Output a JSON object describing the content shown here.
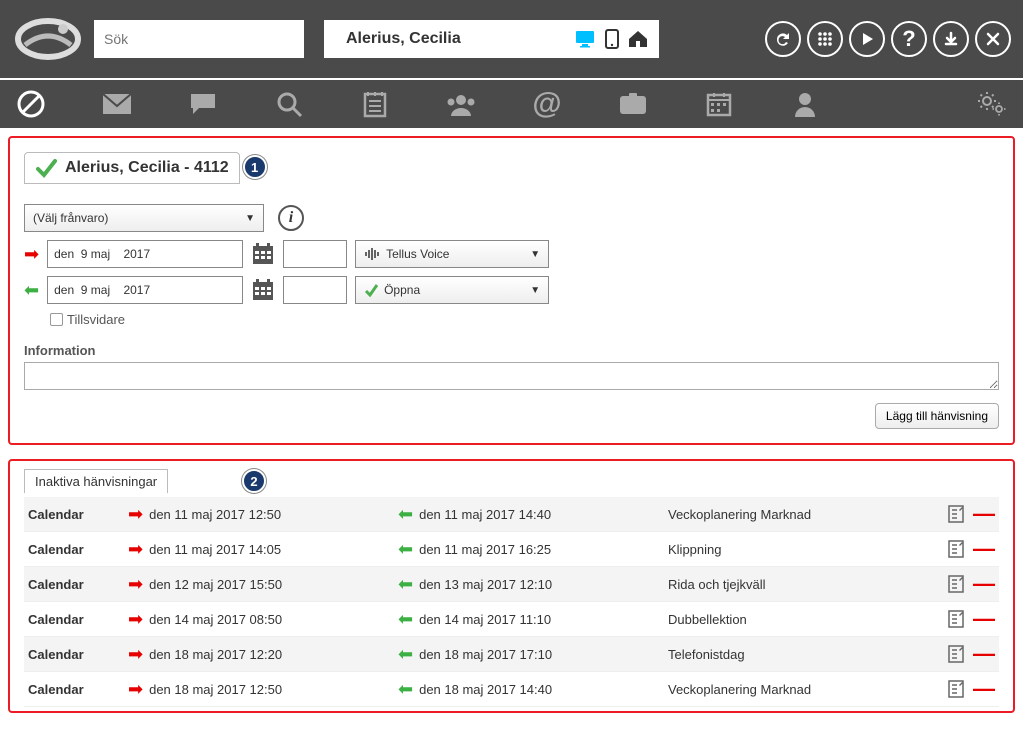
{
  "top": {
    "search_placeholder": "Sök",
    "user_name": "Alerius, Cecilia"
  },
  "panel1": {
    "title": "Alerius, Cecilia - 4112",
    "callout": "1",
    "absence_select": "(Välj frånvaro)",
    "date_out": "den  9 maj    2017",
    "date_in": "den  9 maj    2017",
    "voice_select": "Tellus Voice",
    "open_select": "Öppna",
    "tillsvidare": "Tillsvidare",
    "info_label": "Information",
    "add_btn": "Lägg till hänvisning"
  },
  "panel2": {
    "tab": "Inaktiva hänvisningar",
    "callout": "2",
    "rows": [
      {
        "source": "Calendar",
        "out": "den 11 maj 2017 12:50",
        "in": "den 11 maj 2017 14:40",
        "title": "Veckoplanering Marknad"
      },
      {
        "source": "Calendar",
        "out": "den 11 maj 2017 14:05",
        "in": "den 11 maj 2017 16:25",
        "title": "Klippning"
      },
      {
        "source": "Calendar",
        "out": "den 12 maj 2017 15:50",
        "in": "den 13 maj 2017 12:10",
        "title": "Rida och tjejkväll"
      },
      {
        "source": "Calendar",
        "out": "den 14 maj 2017 08:50",
        "in": "den 14 maj 2017 11:10",
        "title": "Dubbellektion"
      },
      {
        "source": "Calendar",
        "out": "den 18 maj 2017 12:20",
        "in": "den 18 maj 2017 17:10",
        "title": "Telefonistdag"
      },
      {
        "source": "Calendar",
        "out": "den 18 maj 2017 12:50",
        "in": "den 18 maj 2017 14:40",
        "title": "Veckoplanering Marknad"
      }
    ]
  }
}
